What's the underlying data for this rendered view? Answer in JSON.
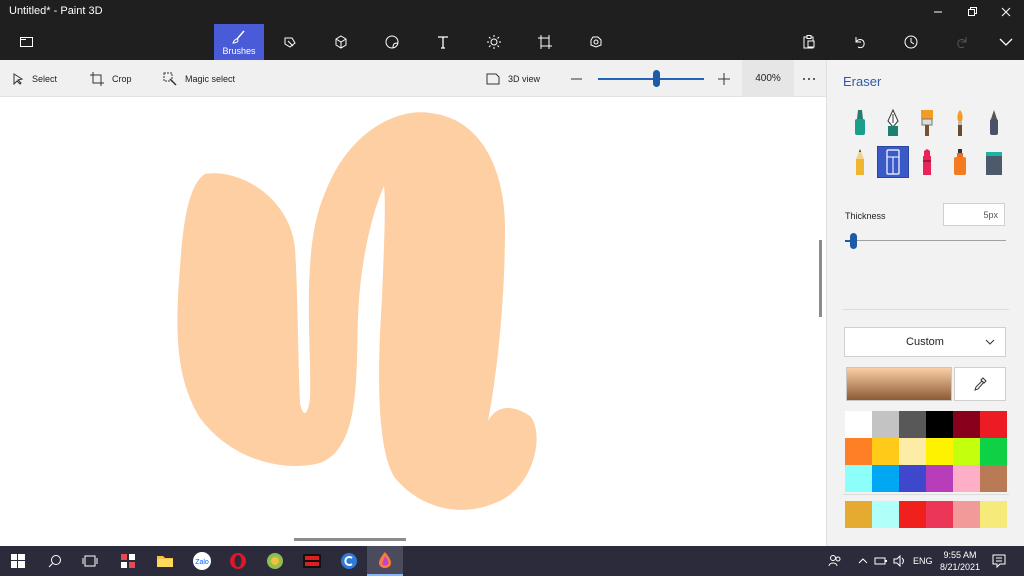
{
  "window": {
    "title": "Untitled* - Paint 3D"
  },
  "ribbon": {
    "active_tab_label": "Brushes",
    "tabs": [
      "menu-icon",
      "brushes-icon",
      "2d-shapes-icon",
      "3d-shapes-icon",
      "stickers-icon",
      "text-icon",
      "effects-icon",
      "canvas-icon",
      "3d-library-icon"
    ],
    "right_icons": [
      "paste-icon",
      "undo-icon",
      "history-icon",
      "redo-icon",
      "expand-icon"
    ]
  },
  "toolbar": {
    "select_label": "Select",
    "crop_label": "Crop",
    "magic_select_label": "Magic select",
    "view3d_label": "3D view",
    "zoom_value": "400%",
    "zoom_level_fraction": 0.55
  },
  "panel": {
    "title": "Eraser",
    "brushes": [
      "marker",
      "calligraphy-pen",
      "oil-brush",
      "watercolor",
      "pixel-pen",
      "pencil",
      "eraser",
      "crayon",
      "spray-can",
      "fill"
    ],
    "selected_brush": "eraser",
    "thickness_label": "Thickness",
    "thickness_value": "5px",
    "thickness_fraction": 0.02,
    "color_dropdown": "Custom",
    "current_color_top": "#fbd0a6",
    "current_color_bottom": "#8b5a36",
    "palette": [
      "#ffffff",
      "#c3c3c3",
      "#585858",
      "#000000",
      "#88001b",
      "#ec1c24",
      "#ff7f27",
      "#ffca18",
      "#fdeca6",
      "#fff200",
      "#c4ff0e",
      "#0ed145",
      "#8cfffb",
      "#00a8f3",
      "#3f48cc",
      "#b83dba",
      "#ffaec8",
      "#b97a56"
    ],
    "custom_palette": [
      "#e5aa30",
      "#b0fff8",
      "#f0201c",
      "#eb3658",
      "#f29a9a",
      "#f5ea7a"
    ]
  },
  "canvas": {
    "stroke_color": "#fdcfa3"
  },
  "taskbar": {
    "apps": [
      "windows-icon",
      "search-icon",
      "task-view-icon",
      "app-icon",
      "file-explorer-icon",
      "zalo-icon",
      "opera-icon",
      "app-icon-2",
      "app-icon-3",
      "app-icon-4",
      "paint3d-icon"
    ],
    "zalo_label": "Zalo",
    "language": "ENG",
    "time": "9:55 AM",
    "date": "8/21/2021"
  }
}
